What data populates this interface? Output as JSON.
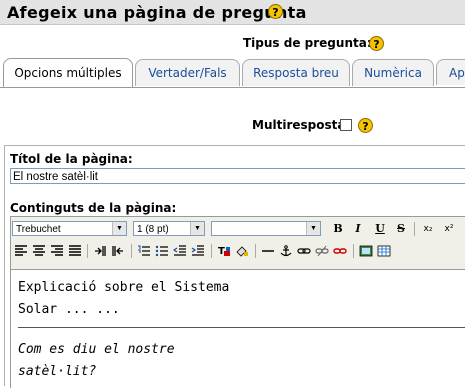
{
  "page": {
    "title": "Afegeix una pàgina de pregunta",
    "help_glyph": "?"
  },
  "question_type": {
    "label": "Tipus de pregunta:"
  },
  "tabs": [
    {
      "label": "Opcions múltiples",
      "active": true
    },
    {
      "label": "Vertader/Fals",
      "active": false
    },
    {
      "label": "Resposta breu",
      "active": false
    },
    {
      "label": "Numèrica",
      "active": false
    },
    {
      "label": "Ap",
      "active": false
    }
  ],
  "multiresponse": {
    "label": "Multiresposta",
    "checked": false
  },
  "page_title_field": {
    "label": "Títol de la pàgina:",
    "value": "El nostre satèl·lit"
  },
  "contents": {
    "label": "Continguts de la pàgina:",
    "toolbar": {
      "font_family": "Trebuchet",
      "font_size": "1 (8 pt)",
      "format": "",
      "bold": "B",
      "italic": "I",
      "underline": "U",
      "strike": "S",
      "subscript": "x₂",
      "superscript": "x²"
    },
    "body": {
      "line1": "Explicació sobre el Sistema",
      "line2": "Solar ... ...",
      "line3": "Com es diu el nostre",
      "line4": "satèl·lit?"
    }
  },
  "colors": {
    "titlebar_bg": "#e3e3e3",
    "tab_link": "#1a4d9a",
    "help_icon": "#f5c400"
  }
}
